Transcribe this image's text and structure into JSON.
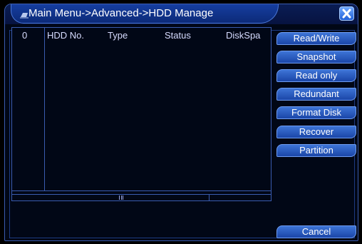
{
  "window": {
    "title": "Main Menu->Advanced->HDD Manage"
  },
  "table": {
    "columns": [
      "0",
      "HDD No.",
      "Type",
      "Status",
      "DiskSpa"
    ],
    "rows": []
  },
  "buttons": {
    "read_write": "Read/Write",
    "snapshot": "Snapshot",
    "read_only": "Read only",
    "redundant": "Redundant",
    "format_disk": "Format Disk",
    "recover": "Recover",
    "partition": "Partition",
    "cancel": "Cancel"
  },
  "icons": {
    "title": "monitor-icon",
    "close": "close-icon"
  },
  "colors": {
    "accent": "#2456c0",
    "background": "#010716",
    "border": "#3a5cb0",
    "text": "#ffffff"
  }
}
